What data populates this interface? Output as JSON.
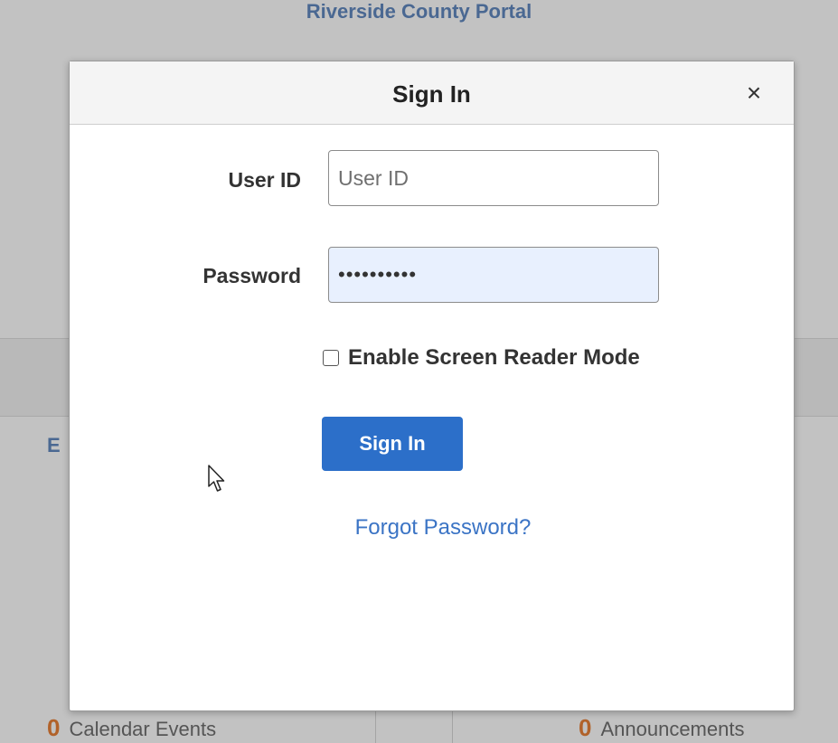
{
  "background": {
    "portal_title": "Riverside County Portal",
    "section_heading": "E",
    "stats": [
      {
        "count": "0",
        "label": "Calendar Events"
      },
      {
        "count": "0",
        "label": "Announcements"
      }
    ]
  },
  "dialog": {
    "title": "Sign In",
    "close_symbol": "×",
    "user_id": {
      "label": "User ID",
      "placeholder": "User ID",
      "value": ""
    },
    "password": {
      "label": "Password",
      "value": "••••••••••"
    },
    "screen_reader": {
      "label": "Enable Screen Reader Mode",
      "checked": false
    },
    "sign_in_button": "Sign In",
    "forgot_password_link": "Forgot Password?"
  },
  "colors": {
    "accent": "#2c6fc9",
    "link": "#3b74c5",
    "portal_title": "#4a6892",
    "overlay": "#c2c2c2"
  }
}
